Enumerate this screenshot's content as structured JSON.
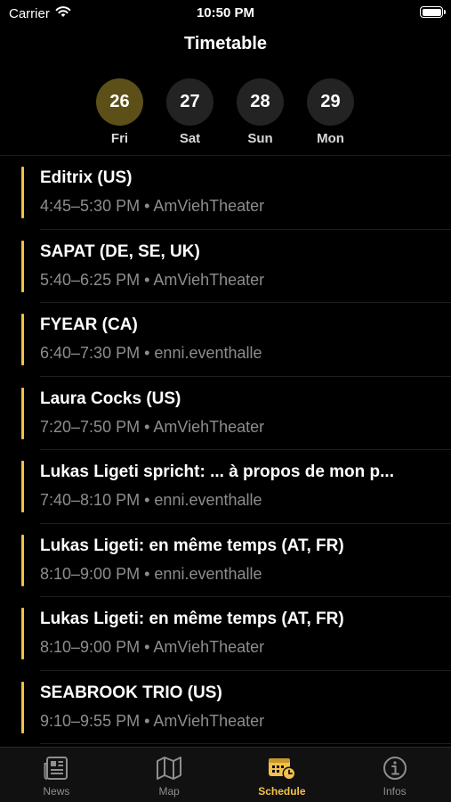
{
  "status_bar": {
    "carrier": "Carrier",
    "time": "10:50 PM"
  },
  "header": {
    "title": "Timetable"
  },
  "days": [
    {
      "number": "26",
      "label": "Fri",
      "selected": true
    },
    {
      "number": "27",
      "label": "Sat",
      "selected": false
    },
    {
      "number": "28",
      "label": "Sun",
      "selected": false
    },
    {
      "number": "29",
      "label": "Mon",
      "selected": false
    }
  ],
  "events": [
    {
      "title": "Editrix (US)",
      "time": "4:45–5:30 PM",
      "venue": "AmViehTheater"
    },
    {
      "title": "SAPAT (DE, SE, UK)",
      "time": "5:40–6:25 PM",
      "venue": "AmViehTheater"
    },
    {
      "title": "FYEAR (CA)",
      "time": "6:40–7:30 PM",
      "venue": "enni.eventhalle"
    },
    {
      "title": "Laura Cocks (US)",
      "time": "7:20–7:50 PM",
      "venue": "AmViehTheater"
    },
    {
      "title": "Lukas Ligeti spricht: ... à propos de mon p...",
      "time": "7:40–8:10 PM",
      "venue": "enni.eventhalle"
    },
    {
      "title": "Lukas Ligeti: en même temps (AT, FR)",
      "time": "8:10–9:00 PM",
      "venue": "enni.eventhalle"
    },
    {
      "title": "Lukas Ligeti: en même temps (AT, FR)",
      "time": "8:10–9:00 PM",
      "venue": "AmViehTheater"
    },
    {
      "title": "SEABROOK TRIO (US)",
      "time": "9:10–9:55 PM",
      "venue": "AmViehTheater"
    }
  ],
  "meta_separator": "•",
  "tabs": [
    {
      "label": "News",
      "icon": "newspaper-icon",
      "active": false
    },
    {
      "label": "Map",
      "icon": "map-icon",
      "active": false
    },
    {
      "label": "Schedule",
      "icon": "calendar-clock-icon",
      "active": true
    },
    {
      "label": "Infos",
      "icon": "info-circle-icon",
      "active": false
    }
  ],
  "colors": {
    "accent": "#f2c14a",
    "selected_day_bg": "#5c4f18",
    "day_bg": "#232323",
    "secondary_text": "#8d8d8d",
    "background": "#000000"
  }
}
